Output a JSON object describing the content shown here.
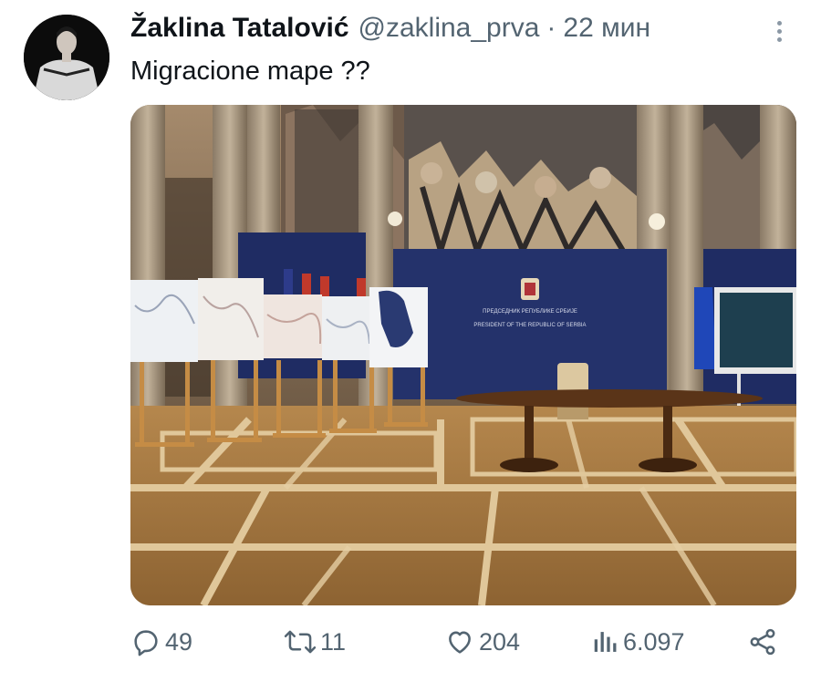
{
  "tweet": {
    "author_name": "Žaklina Tatalović",
    "handle": "@zaklina_prva",
    "separator": "·",
    "time": "22 мин",
    "text": "Migracione mape ??"
  },
  "image_text": {
    "placard_line1": "ПРЕДСЕДНИК РЕПУБЛИКЕ СРБИЈЕ",
    "placard_line2": "PRESIDENT OF THE REPUBLIC OF SERBIA"
  },
  "actions": {
    "replies": "49",
    "retweets": "11",
    "likes": "204",
    "views": "6.097"
  },
  "icons": {
    "reply": "reply-icon",
    "retweet": "retweet-icon",
    "like": "heart-icon",
    "views": "views-icon",
    "share": "share-icon",
    "more": "more-icon"
  },
  "colors": {
    "text": "#0f1419",
    "secondary": "#536471",
    "backdrop": "#24326b",
    "floor": "#9a6e36"
  }
}
